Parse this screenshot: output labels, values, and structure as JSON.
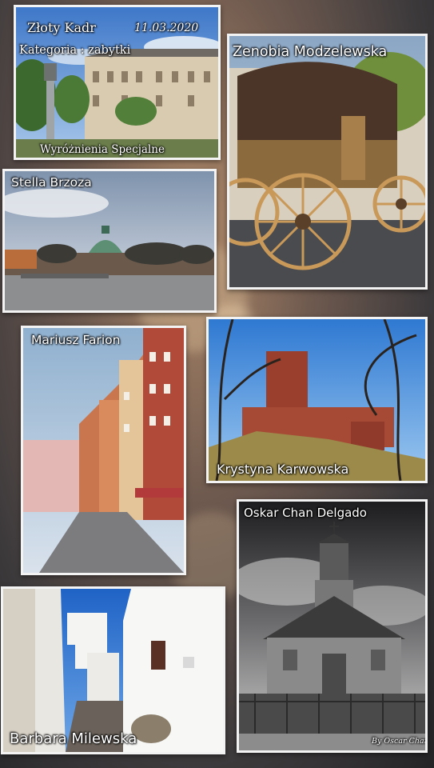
{
  "header": {
    "title": "Złoty Kadr",
    "date": "11.03.2020",
    "category": "Kategoria : zabytki",
    "subtitle": "Wyróżnienia Specjalne"
  },
  "photos": [
    {
      "author": "Zenobia Modzelewska"
    },
    {
      "author": "Stella Brzoza"
    },
    {
      "author": "Mariusz Farion"
    },
    {
      "author": "Krystyna Karwowska"
    },
    {
      "author": "Oskar Chan Delgado",
      "signature": "By Oscar Chang"
    },
    {
      "author": "Barbara Milewska"
    }
  ]
}
